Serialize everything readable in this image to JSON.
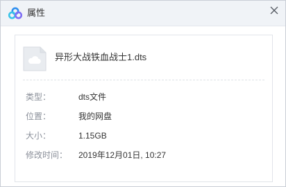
{
  "window": {
    "title": "属性",
    "logo_icon": "baidu-netdisk-cloud-icon",
    "close_icon": "close-icon"
  },
  "file": {
    "name": "异形大战铁血战士1.dts",
    "icon": "cloud-file-icon"
  },
  "properties": [
    {
      "label": "类型：",
      "value": "dts文件"
    },
    {
      "label": "位置：",
      "value": "我的网盘"
    },
    {
      "label": "大小：",
      "value": "1.15GB"
    },
    {
      "label": "修改时间：",
      "value": "2019年12月01日, 10:27"
    }
  ],
  "colors": {
    "titlebar_bg": "#f0f3f7",
    "label_text": "#8a8f99",
    "value_text": "#333333",
    "logo_blue": "#2f8ff0",
    "logo_teal": "#37c3e8",
    "logo_purple": "#7e6ef5"
  }
}
